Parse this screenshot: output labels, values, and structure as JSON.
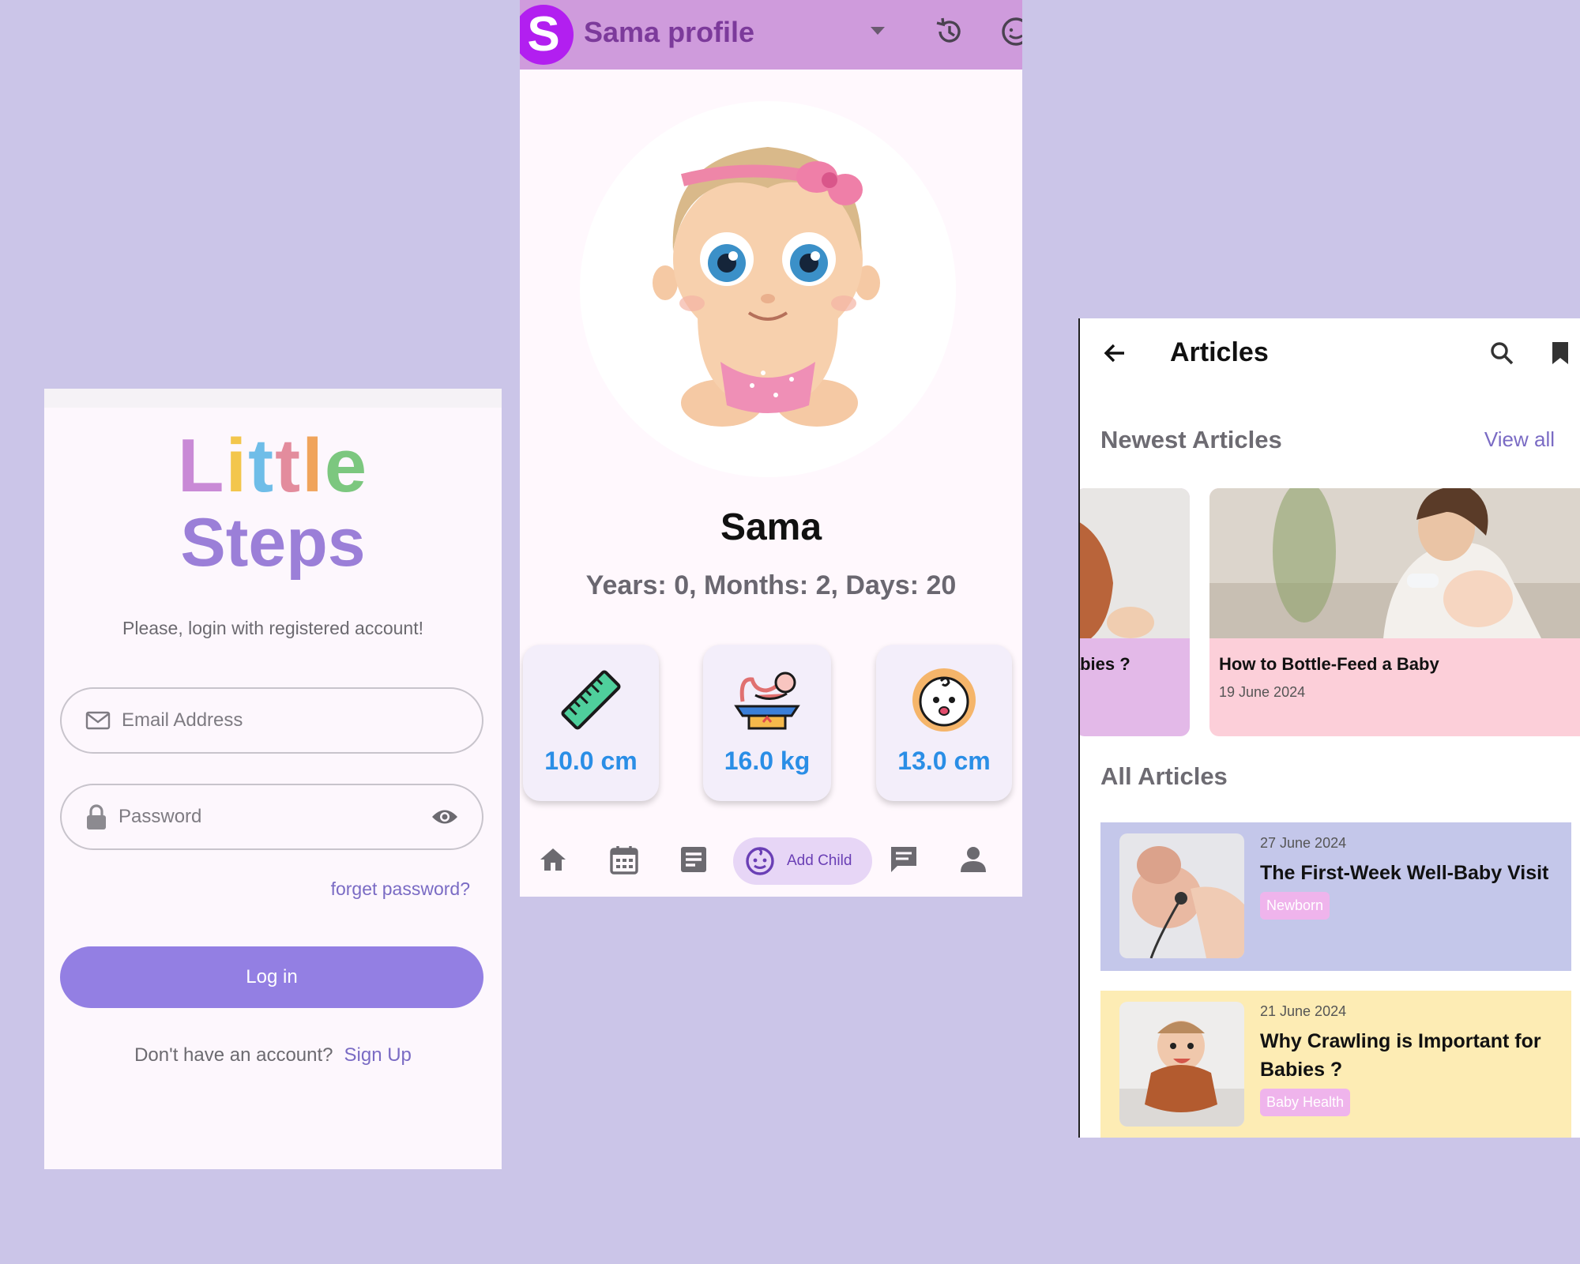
{
  "login": {
    "logo_line1": [
      "L",
      "i",
      "t",
      "t",
      "l",
      "e"
    ],
    "logo_line2": "Steps",
    "prompt": "Please, login with registered account!",
    "email_placeholder": "Email Address",
    "password_placeholder": "Password",
    "forgot_label": "forget password?",
    "login_label": "Log in",
    "no_account_text": "Don't have an account?",
    "signup_label": "Sign Up",
    "button_color": "#937fe3"
  },
  "profile": {
    "header_title": "Sama profile",
    "badge_letter": "S",
    "child_name": "Sama",
    "age_text": "Years: 0, Months: 2, Days: 20",
    "stats": [
      {
        "icon": "ruler-icon",
        "value": "10.0 cm"
      },
      {
        "icon": "baby-scale-icon",
        "value": "16.0 kg"
      },
      {
        "icon": "baby-face-icon",
        "value": "13.0 cm"
      }
    ],
    "nav": {
      "add_child_label": "Add Child"
    },
    "header_color": "#cf9bdc"
  },
  "articles": {
    "title": "Articles",
    "newest_heading": "Newest Articles",
    "view_all_label": "View all",
    "newest": [
      {
        "title": "Babies ?",
        "date": ""
      },
      {
        "title": "How to Bottle-Feed a Baby",
        "date": "19 June 2024"
      }
    ],
    "all_heading": "All Articles",
    "all": [
      {
        "date": "27 June 2024",
        "title": "The First-Week Well-Baby Visit",
        "tag": "Newborn"
      },
      {
        "date": "21 June 2024",
        "title": "Why Crawling is Important for Babies ?",
        "tag": "Baby Health"
      }
    ]
  }
}
